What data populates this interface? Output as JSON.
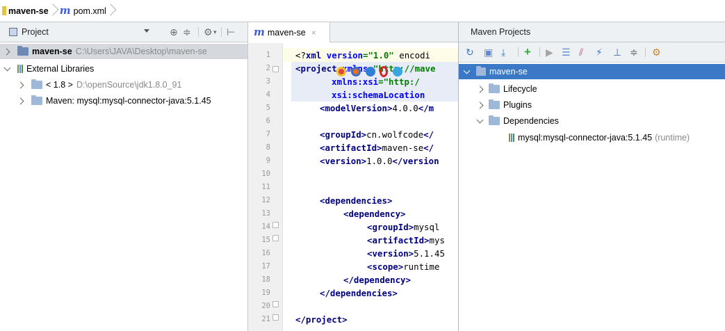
{
  "navbar": {
    "project_name": "maven-se",
    "file_icon": "m-icon",
    "file_name": "pom.xml"
  },
  "project_panel": {
    "title": "Project",
    "toolbar_icons": [
      "sync-icon",
      "collapse-all-icon",
      "settings-icon",
      "hide-panel-icon"
    ],
    "tree": [
      {
        "label": "maven-se",
        "path": "C:\\Users\\JAVA\\Desktop\\maven-se",
        "expanded": false,
        "selected": true
      },
      {
        "label": "External Libraries",
        "expanded": true
      },
      {
        "label": "< 1.8 >",
        "path": "D:\\openSource\\jdk1.8.0_91",
        "expanded": false
      },
      {
        "label": "Maven: mysql:mysql-connector-java:5.1.45",
        "expanded": false
      }
    ]
  },
  "editor": {
    "tab_label": "maven-se",
    "tab_close": "×",
    "line_numbers": [
      "1",
      "2",
      "3",
      "4",
      "5",
      "6",
      "7",
      "8",
      "9",
      "10",
      "11",
      "12",
      "13",
      "14",
      "15",
      "16",
      "17",
      "18",
      "19",
      "20",
      "21"
    ],
    "lines": {
      "l1_pi": "<?",
      "l1_tag": "xml",
      "l1_attr": " version",
      "l1_eq": "=",
      "l1_val": "\"1.0\"",
      "l1_rest": " encodi",
      "l2_open": "<",
      "l2_tag": "project",
      "l2_attr": " xmlns",
      "l2_val": "=\"http://mave",
      "l3_attr": "xmlns:xsi",
      "l3_val": "=\"http:/",
      "l4_attr": "xsi:schemaLocation",
      "l5_open": "<modelVersion>",
      "l5_text": "4.0.0",
      "l5_close": "</m",
      "l7_open": "<groupId>",
      "l7_text": "cn.wolfcode",
      "l7_close": "</",
      "l8_open": "<artifactId>",
      "l8_text": "maven-se",
      "l8_close": "</",
      "l9_open": "<version>",
      "l9_text": "1.0.0",
      "l9_close": "</version",
      "l12": "<dependencies>",
      "l13": "<dependency>",
      "l14_open": "<groupId>",
      "l14_text": "mysql",
      "l15_open": "<artifactId>",
      "l15_text": "mys",
      "l16_open": "<version>",
      "l16_text": "5.1.45",
      "l17_open": "<scope>",
      "l17_text": "runtime",
      "l18": "</dependency>",
      "l19": "</dependencies>",
      "l21": "</project>"
    }
  },
  "maven_panel": {
    "title": "Maven Projects",
    "toolbar_icons": [
      "reimport-icon",
      "generate-sources-icon",
      "download-icon",
      "add-icon",
      "run-icon",
      "run-config-icon",
      "toggle-offline-icon",
      "skip-tests-icon",
      "show-dependencies-icon",
      "collapse-all-icon",
      "settings-icon"
    ],
    "tree": [
      {
        "label": "maven-se",
        "expanded": true,
        "selected": true
      },
      {
        "label": "Lifecycle",
        "expanded": false
      },
      {
        "label": "Plugins",
        "expanded": false
      },
      {
        "label": "Dependencies",
        "expanded": true
      },
      {
        "label": "mysql:mysql-connector-java:5.1.45",
        "scope": "(runtime)"
      }
    ]
  },
  "colors": {
    "selection_blue": "#3b78c6",
    "panel_header": "#eef1f4",
    "xml_tag": "#000080",
    "xml_attr": "#0000ff",
    "xml_value": "#008000"
  }
}
